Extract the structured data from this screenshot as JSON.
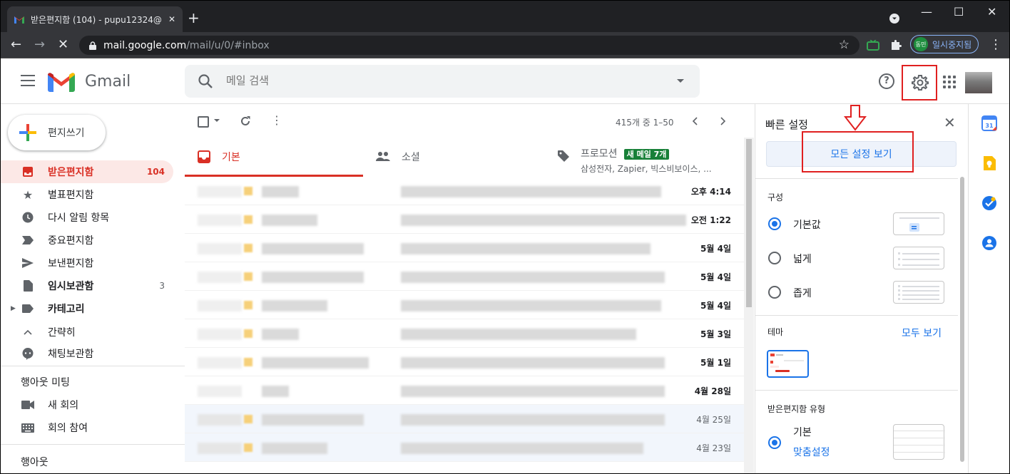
{
  "browser": {
    "tab_title": "받은편지함 (104) - pupu12324@",
    "tab_close": "✕",
    "new_tab": "+",
    "url_host": "mail.google.com",
    "url_path": "/mail/u/0/#inbox",
    "profile_avatar": "동민",
    "profile_status": "일시중지됨",
    "min_glyph": "—",
    "max_glyph": "☐",
    "close_glyph": "✕",
    "back_glyph": "←",
    "forward_glyph": "→",
    "stop_glyph": "✕",
    "menu_glyph": "⋮",
    "star_glyph": "☆",
    "accent": "#8ab4f8"
  },
  "gmail": {
    "logo_text": "Gmail",
    "search_placeholder": "메일 검색",
    "help_glyph": "?",
    "highlight_color": "#e02020"
  },
  "sidebar": {
    "compose": "편지쓰기",
    "items": [
      {
        "label": "받은편지함",
        "count": "104",
        "icon": "inbox-icon"
      },
      {
        "label": "별표편지함",
        "count": "",
        "icon": "star-icon"
      },
      {
        "label": "다시 알림 항목",
        "count": "",
        "icon": "clock-icon"
      },
      {
        "label": "중요편지함",
        "count": "",
        "icon": "label-important-icon"
      },
      {
        "label": "보낸편지함",
        "count": "",
        "icon": "send-icon"
      },
      {
        "label": "임시보관함",
        "count": "3",
        "icon": "draft-icon"
      },
      {
        "label": "카테고리",
        "count": "",
        "icon": "label-icon"
      },
      {
        "label": "간략히",
        "count": "",
        "icon": "chevron-up-icon"
      },
      {
        "label": "채팅보관함",
        "count": "",
        "icon": "chat-icon"
      }
    ],
    "meet_title": "행아웃 미팅",
    "meet_items": [
      {
        "label": "새 회의",
        "icon": "video-icon"
      },
      {
        "label": "회의 참여",
        "icon": "keyboard-icon"
      }
    ],
    "hangouts_title": "행아웃"
  },
  "main": {
    "pager": "415개 중 1–50",
    "tabs": [
      {
        "label": "기본",
        "sub": "",
        "icon": "inbox-icon"
      },
      {
        "label": "소셜",
        "sub": "",
        "icon": "people-icon"
      },
      {
        "label": "프로모션",
        "sub": "삼성전자, Zapier, 빅스비보이스, ...",
        "badge": "새 메일 7개",
        "icon": "tag-icon"
      }
    ],
    "rows": [
      {
        "date": "오후 4:14",
        "read": false
      },
      {
        "date": "오전 1:22",
        "read": false
      },
      {
        "date": "5월 4일",
        "read": false
      },
      {
        "date": "5월 4일",
        "read": false
      },
      {
        "date": "5월 4일",
        "read": false
      },
      {
        "date": "5월 3일",
        "read": false
      },
      {
        "date": "5월 1일",
        "read": false
      },
      {
        "date": "4월 28일",
        "read": false
      },
      {
        "date": "4월 25일",
        "read": true
      },
      {
        "date": "4월 23일",
        "read": true
      }
    ]
  },
  "quick_settings": {
    "title": "빠른 설정",
    "close_glyph": "✕",
    "all_settings": "모든 설정 보기",
    "density_title": "구성",
    "density_options": [
      {
        "label": "기본값",
        "selected": true
      },
      {
        "label": "넓게",
        "selected": false
      },
      {
        "label": "좁게",
        "selected": false
      }
    ],
    "theme_title": "테마",
    "theme_link": "모두 보기",
    "inbox_type_title": "받은편지함 유형",
    "inbox_type_option": "기본",
    "inbox_type_link": "맞춤설정"
  }
}
